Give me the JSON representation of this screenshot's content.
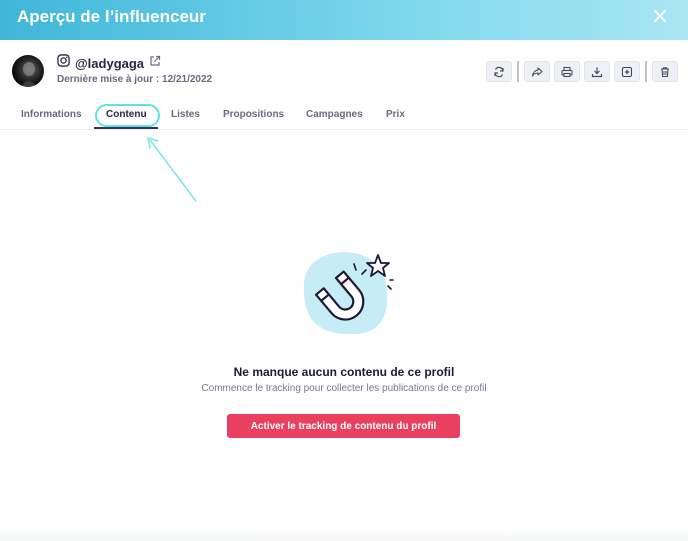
{
  "header": {
    "title": "Aperçu de l’influenceur"
  },
  "profile": {
    "handle": "@ladygaga",
    "update_label": "Dernière mise à jour :",
    "update_date": "12/21/2022"
  },
  "toolbar": {
    "buttons": [
      "refresh-icon",
      "share-icon",
      "print-icon",
      "download-icon",
      "add-icon",
      "trash-icon"
    ]
  },
  "tabs": [
    {
      "label": "Informations"
    },
    {
      "label": "Contenu",
      "active": true
    },
    {
      "label": "Listes"
    },
    {
      "label": "Propositions"
    },
    {
      "label": "Campagnes"
    },
    {
      "label": "Prix"
    }
  ],
  "empty_state": {
    "title": "Ne manque aucun contenu de ce profil",
    "subtitle": "Commence le tracking pour collecter les publications de ce profil",
    "cta_label": "Activer le tracking de contenu du profil"
  },
  "colors": {
    "header_start": "#3fb6d9",
    "header_end": "#a9e6f3",
    "cta": "#e8405e",
    "highlight": "#5ee2e2",
    "blob": "#c6ecf7"
  }
}
